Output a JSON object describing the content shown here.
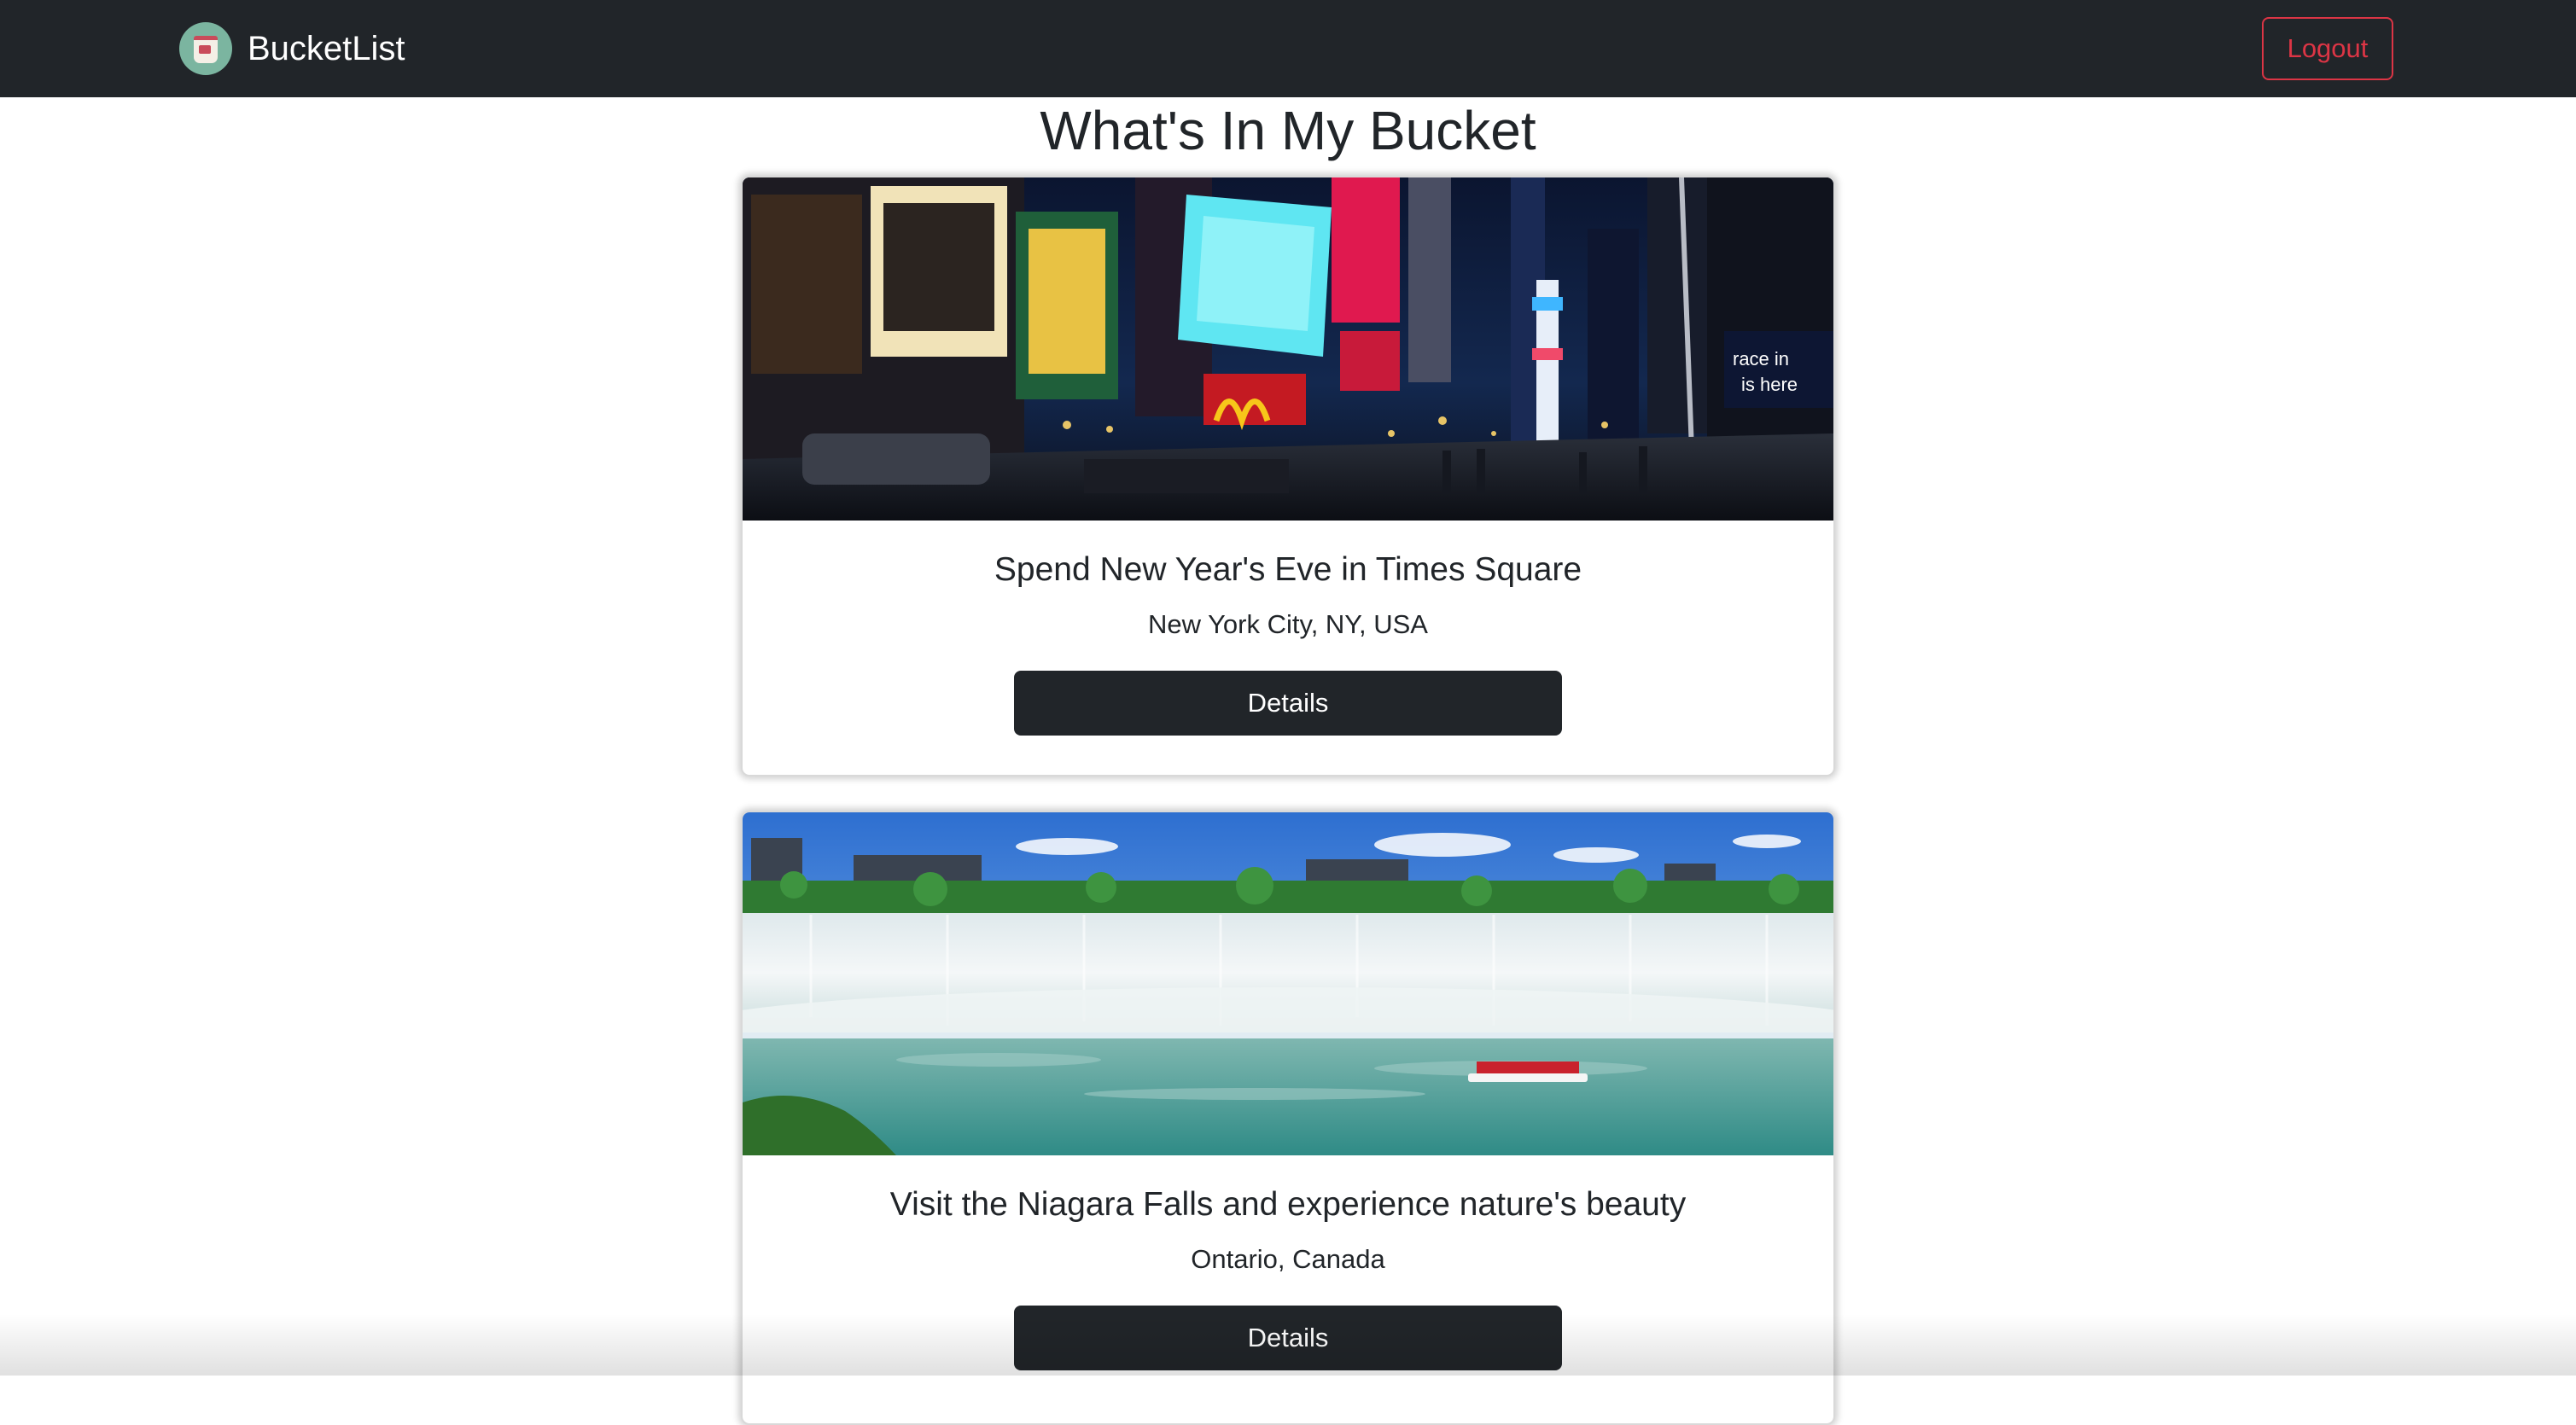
{
  "navbar": {
    "brand_name": "BucketList",
    "logo_icon": "bucket-logo-icon",
    "logout_label": "Logout"
  },
  "page": {
    "title": "What's In My Bucket"
  },
  "cards": [
    {
      "title": "Spend New Year's Eve in Times Square",
      "location": "New York City, NY, USA",
      "details_label": "Details",
      "image": "times-square-photo"
    },
    {
      "title": "Visit the Niagara Falls and experience nature's beauty",
      "location": "Ontario, Canada",
      "details_label": "Details",
      "image": "niagara-falls-photo"
    }
  ],
  "colors": {
    "navbar_bg": "#212529",
    "logout_accent": "#dc3545",
    "button_bg": "#212529"
  }
}
